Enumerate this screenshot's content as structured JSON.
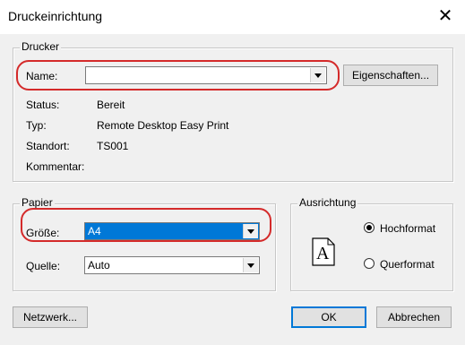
{
  "dialog": {
    "title": "Druckeinrichtung",
    "close_glyph": "✕"
  },
  "printer": {
    "group_label": "Drucker",
    "name_label": "Name:",
    "name_value": "",
    "properties_button": "Eigenschaften...",
    "status_label": "Status:",
    "status_value": "Bereit",
    "type_label": "Typ:",
    "type_value": "Remote Desktop Easy Print",
    "location_label": "Standort:",
    "location_value": "TS001",
    "comment_label": "Kommentar:",
    "comment_value": ""
  },
  "paper": {
    "group_label": "Papier",
    "size_label": "Größe:",
    "size_value": "A4",
    "source_label": "Quelle:",
    "source_value": "Auto"
  },
  "orientation": {
    "group_label": "Ausrichtung",
    "portrait_label": "Hochformat",
    "landscape_label": "Querformat",
    "portrait_checked": true,
    "preview_letter": "A"
  },
  "footer": {
    "network_button": "Netzwerk...",
    "ok_button": "OK",
    "cancel_button": "Abbrechen"
  },
  "colors": {
    "highlight": "#0078d7",
    "annotation_red": "#d42a2a"
  }
}
